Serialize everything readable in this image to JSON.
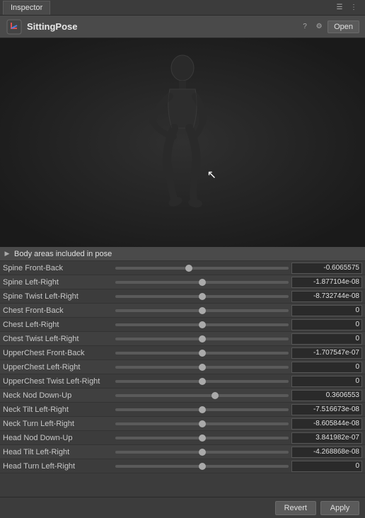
{
  "tab": {
    "label": "Inspector",
    "icons": [
      "☰",
      "⋮"
    ]
  },
  "header": {
    "title": "SittingPose",
    "open_label": "Open",
    "icons": [
      "?",
      "⚙",
      "↗"
    ]
  },
  "section": {
    "label": "Body areas included in pose"
  },
  "sliders": [
    {
      "label": "Spine Front-Back",
      "value": "-0.6065575",
      "thumb_pct": 42
    },
    {
      "label": "Spine Left-Right",
      "value": "-1.877104e-08",
      "thumb_pct": 50
    },
    {
      "label": "Spine Twist Left-Right",
      "value": "-8.732744e-08",
      "thumb_pct": 50
    },
    {
      "label": "Chest Front-Back",
      "value": "0",
      "thumb_pct": 50
    },
    {
      "label": "Chest Left-Right",
      "value": "0",
      "thumb_pct": 50
    },
    {
      "label": "Chest Twist Left-Right",
      "value": "0",
      "thumb_pct": 50
    },
    {
      "label": "UpperChest Front-Back",
      "value": "-1.707547e-07",
      "thumb_pct": 50
    },
    {
      "label": "UpperChest Left-Right",
      "value": "0",
      "thumb_pct": 50
    },
    {
      "label": "UpperChest Twist Left-Right",
      "value": "0",
      "thumb_pct": 50
    },
    {
      "label": "Neck Nod Down-Up",
      "value": "0.3606553",
      "thumb_pct": 58
    },
    {
      "label": "Neck Tilt Left-Right",
      "value": "-7.516673e-08",
      "thumb_pct": 50
    },
    {
      "label": "Neck Turn Left-Right",
      "value": "-8.605844e-08",
      "thumb_pct": 50
    },
    {
      "label": "Head Nod Down-Up",
      "value": "3.841982e-07",
      "thumb_pct": 50
    },
    {
      "label": "Head Tilt Left-Right",
      "value": "-4.268868e-08",
      "thumb_pct": 50
    },
    {
      "label": "Head Turn Left-Right",
      "value": "0",
      "thumb_pct": 50
    }
  ],
  "footer": {
    "revert_label": "Revert",
    "apply_label": "Apply"
  }
}
